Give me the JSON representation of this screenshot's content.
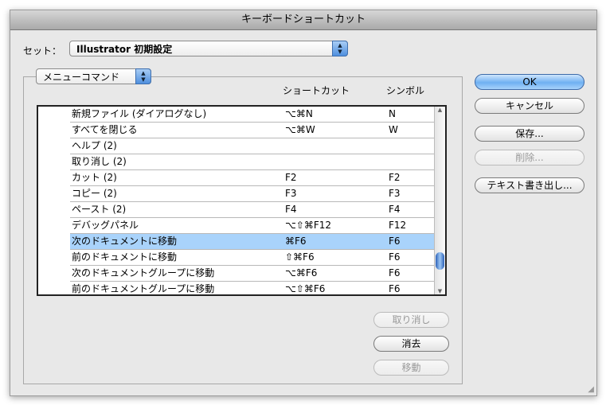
{
  "window": {
    "title": "キーボードショートカット"
  },
  "set": {
    "label": "セット：",
    "value": "Illustrator 初期設定"
  },
  "category": {
    "value": "メニューコマンド"
  },
  "columns": {
    "shortcut": "ショートカット",
    "symbol": "シンボル"
  },
  "rows": [
    {
      "command": "新規ファイル (ダイアログなし)",
      "shortcut": "⌥⌘N",
      "symbol": "N"
    },
    {
      "command": "すべてを閉じる",
      "shortcut": "⌥⌘W",
      "symbol": "W"
    },
    {
      "command": "ヘルプ (2)",
      "shortcut": "",
      "symbol": ""
    },
    {
      "command": "取り消し (2)",
      "shortcut": "",
      "symbol": ""
    },
    {
      "command": "カット (2)",
      "shortcut": "F2",
      "symbol": "F2"
    },
    {
      "command": "コピー (2)",
      "shortcut": "F3",
      "symbol": "F3"
    },
    {
      "command": "ペースト (2)",
      "shortcut": "F4",
      "symbol": "F4"
    },
    {
      "command": "デバッグパネル",
      "shortcut": "⌥⇧⌘F12",
      "symbol": "F12"
    },
    {
      "command": "次のドキュメントに移動",
      "shortcut": "⌘F6",
      "symbol": "F6",
      "selected": true
    },
    {
      "command": "前のドキュメントに移動",
      "shortcut": "⇧⌘F6",
      "symbol": "F6"
    },
    {
      "command": "次のドキュメントグループに移動",
      "shortcut": "⌥⌘F6",
      "symbol": "F6"
    },
    {
      "command": "前のドキュメントグループに移動",
      "shortcut": "⌥⇧⌘F6",
      "symbol": "F6"
    }
  ],
  "buttons": {
    "ok": "OK",
    "cancel": "キャンセル",
    "save": "保存...",
    "delete": "削除...",
    "export": "テキスト書き出し...",
    "undo": "取り消し",
    "clear": "消去",
    "move": "移動"
  },
  "scrollbar": {
    "position": 0.9
  }
}
